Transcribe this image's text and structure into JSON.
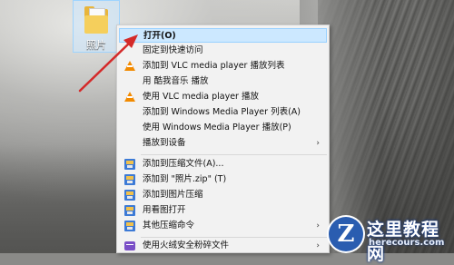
{
  "desktop": {
    "icon_label": "照片"
  },
  "context_menu": {
    "items": [
      {
        "label": "打开(O)",
        "icon": "none",
        "highlighted": true
      },
      {
        "label": "固定到快速访问",
        "icon": "none"
      },
      {
        "label": "添加到 VLC media player 播放列表",
        "icon": "vlc-cone-icon"
      },
      {
        "label": "用 酷我音乐 播放",
        "icon": "none"
      },
      {
        "label": "使用 VLC media player 播放",
        "icon": "vlc-cone-icon"
      },
      {
        "label": "添加到 Windows Media Player 列表(A)",
        "icon": "none"
      },
      {
        "label": "使用 Windows Media Player 播放(P)",
        "icon": "none"
      },
      {
        "label": "播放到设备",
        "icon": "none",
        "submenu": true
      },
      {
        "label": "添加到压缩文件(A)...",
        "icon": "archive-icon"
      },
      {
        "label": "添加到 \"照片.zip\" (T)",
        "icon": "archive-icon"
      },
      {
        "label": "添加到图片压缩",
        "icon": "archive-icon"
      },
      {
        "label": "用看图打开",
        "icon": "archive-icon"
      },
      {
        "label": "其他压缩命令",
        "icon": "archive-icon",
        "submenu": true
      },
      {
        "label": "使用火绒安全粉碎文件",
        "icon": "shredder-icon",
        "submenu": true
      }
    ],
    "submenu_arrow": "›"
  },
  "watermark": {
    "logo_letter": "Z",
    "name": "这里教程网",
    "url": "herecours.com"
  }
}
